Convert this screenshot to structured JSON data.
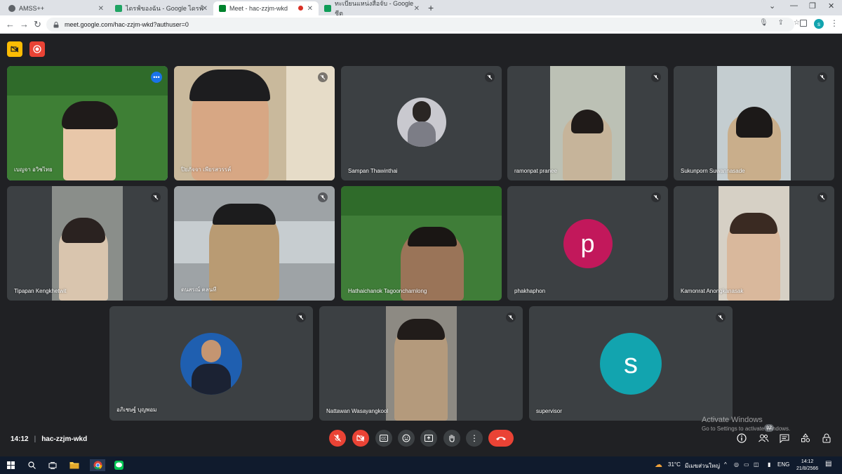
{
  "browser": {
    "tabs": [
      {
        "title": "AMSS++",
        "color": "#5f6368"
      },
      {
        "title": "ไดรฟ์ของฉัน - Google ไดรฟ์",
        "color": "#1fa463"
      },
      {
        "title": "Meet - hac-zzjm-wkd",
        "color": "#00832d"
      },
      {
        "title": "ทะเบียนแหน่งสือจับ - Google ชีต",
        "color": "#0f9d58"
      }
    ],
    "url": "meet.google.com/hac-zzjm-wkd?authuser=0",
    "profile_initial": "s"
  },
  "participants": [
    {
      "name": "เบญจา อวิชไทย",
      "bg": "#4a8a3c"
    },
    {
      "name": "ปิยภัจจา เพียรสวรรค์",
      "bg": "#9a8b72"
    },
    {
      "name": "Sampan Thawinthai",
      "bg": "#3c4043"
    },
    {
      "name": "ramonpat pranee",
      "bg": "#b7b9a8"
    },
    {
      "name": "Sukunporn Suwannasade",
      "bg": "#b6c2c7"
    },
    {
      "name": "Tipapan Kengkhetwit",
      "bg": "#8a8e8a"
    },
    {
      "name": "ดนสรณ์ คลนที",
      "bg": "#8b8f92"
    },
    {
      "name": "Hathaichanok Tagooncharnlong",
      "bg": "#3f7d38"
    },
    {
      "name": "phakhaphon",
      "avatar": "p",
      "avatar_color": "#c2185b"
    },
    {
      "name": "Kamonrat Anongkanasak",
      "bg": "#c9c2b6"
    },
    {
      "name": "อภิเชษฐ์ บุญพอม",
      "bg": "#3c4043"
    },
    {
      "name": "Nattawan Wasayangkool",
      "bg": "#8d8a83"
    },
    {
      "name": "supervisor",
      "avatar": "s",
      "avatar_color": "#12a4af"
    }
  ],
  "meeting": {
    "time": "14:12",
    "code": "hac-zzjm-wkd",
    "people_count": "12"
  },
  "watermark": {
    "line1": "Activate Windows",
    "line2": "Go to Settings to activate Windows."
  },
  "taskbar": {
    "temperature": "31°C",
    "weather_text": "มีเมฆส่วนใหญ่",
    "language": "ENG",
    "time": "14:12",
    "date": "21/8/2566"
  },
  "colors": {
    "hangup": "#ea4335",
    "active_outline": "#8ab4f8",
    "meet_bg": "#202124",
    "tile_bg": "#3c4043"
  }
}
